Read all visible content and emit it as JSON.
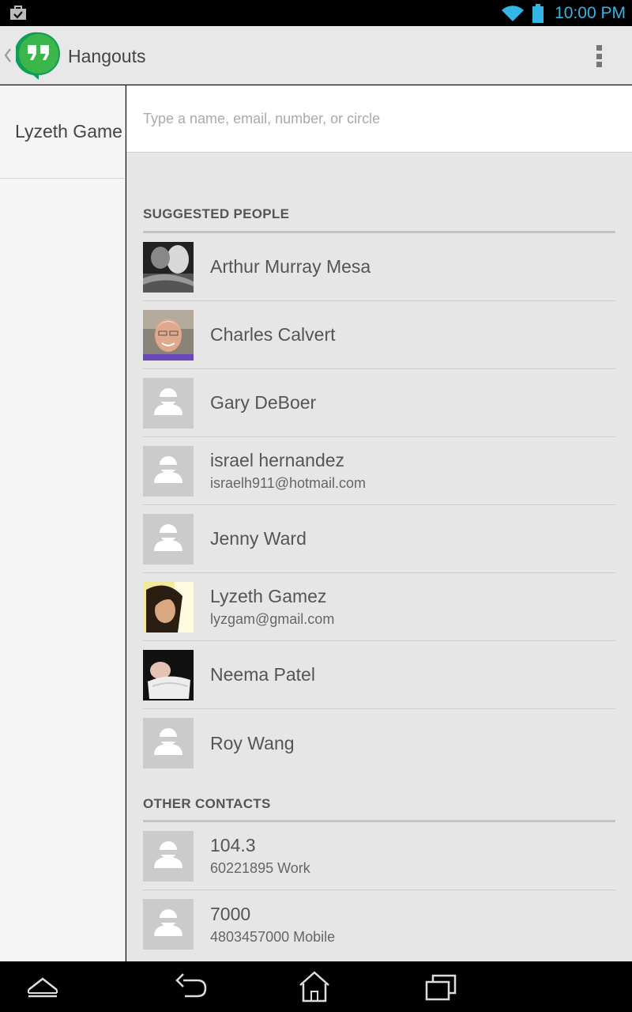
{
  "status_bar": {
    "time": "10:00 PM",
    "accent_color": "#33b5e5",
    "icons": [
      "shopping-bag-icon",
      "wifi-icon",
      "battery-icon"
    ]
  },
  "action_bar": {
    "title": "Hangouts",
    "logo": "hangouts-logo",
    "menu_icon": "overflow-menu-icon"
  },
  "left_pane": {
    "items": [
      {
        "label": "Lyzeth Game"
      }
    ]
  },
  "search": {
    "placeholder": "Type a name, email, number, or circle",
    "value": ""
  },
  "suggested": {
    "header": "SUGGESTED PEOPLE",
    "contacts": [
      {
        "name": "Arthur Murray Mesa",
        "subtitle": ""
      },
      {
        "name": "Charles Calvert",
        "subtitle": ""
      },
      {
        "name": "Gary DeBoer",
        "subtitle": ""
      },
      {
        "name": "israel hernandez",
        "subtitle": "israelh911@hotmail.com"
      },
      {
        "name": "Jenny Ward",
        "subtitle": ""
      },
      {
        "name": "Lyzeth Gamez",
        "subtitle": "lyzgam@gmail.com"
      },
      {
        "name": "Neema Patel",
        "subtitle": ""
      },
      {
        "name": "Roy Wang",
        "subtitle": ""
      }
    ]
  },
  "other": {
    "header": "OTHER CONTACTS",
    "contacts": [
      {
        "name": "104.3",
        "subtitle": "60221895 Work"
      },
      {
        "name": "7000",
        "subtitle": "4803457000 Mobile"
      }
    ]
  },
  "nav_bar": {
    "icons": [
      "collapse-icon",
      "back-icon",
      "home-icon",
      "recent-apps-icon"
    ]
  }
}
